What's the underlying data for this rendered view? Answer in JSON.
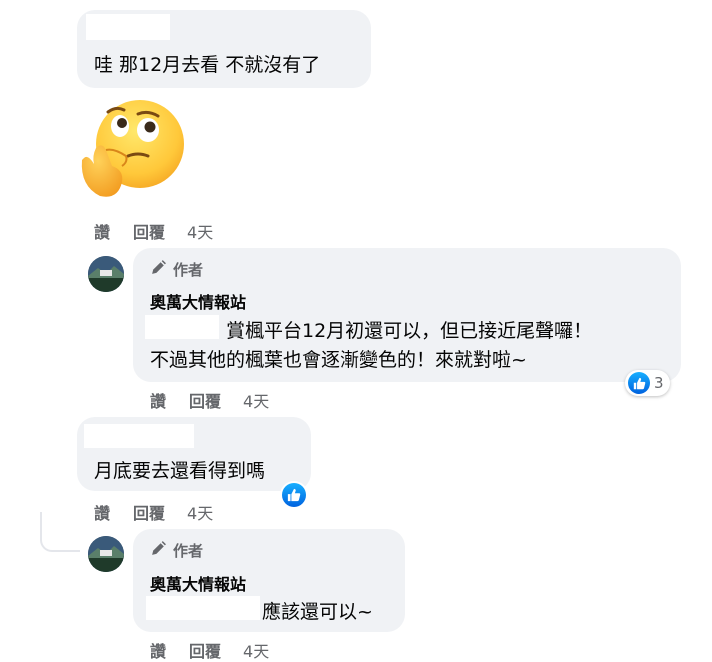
{
  "comments": [
    {
      "text": "哇 那12月去看 不就沒有了",
      "actions": {
        "like": "讚",
        "reply": "回覆",
        "time": "4天"
      }
    },
    {
      "author_badge": "作者",
      "author_name": "奧萬大情報站",
      "line1": "賞楓平台12月初還可以，但已接近尾聲囉！",
      "line2": "不過其他的楓葉也會逐漸變色的！來就對啦~",
      "reaction_count": "3",
      "actions": {
        "like": "讚",
        "reply": "回覆",
        "time": "4天"
      }
    },
    {
      "text": "月底要去還看得到嗎",
      "actions": {
        "like": "讚",
        "reply": "回覆",
        "time": "4天"
      }
    },
    {
      "author_badge": "作者",
      "author_name": "奧萬大情報站",
      "line1": "應該還可以~",
      "actions": {
        "like": "讚",
        "reply": "回覆",
        "time": "4天"
      }
    }
  ],
  "icons": {
    "sticker": "thinking-face-icon",
    "author": "pencil-icon",
    "like": "thumbs-up-icon"
  },
  "colors": {
    "bubble": "#f0f2f5",
    "secondary_text": "#65676b",
    "like_blue": "#1877f2"
  }
}
